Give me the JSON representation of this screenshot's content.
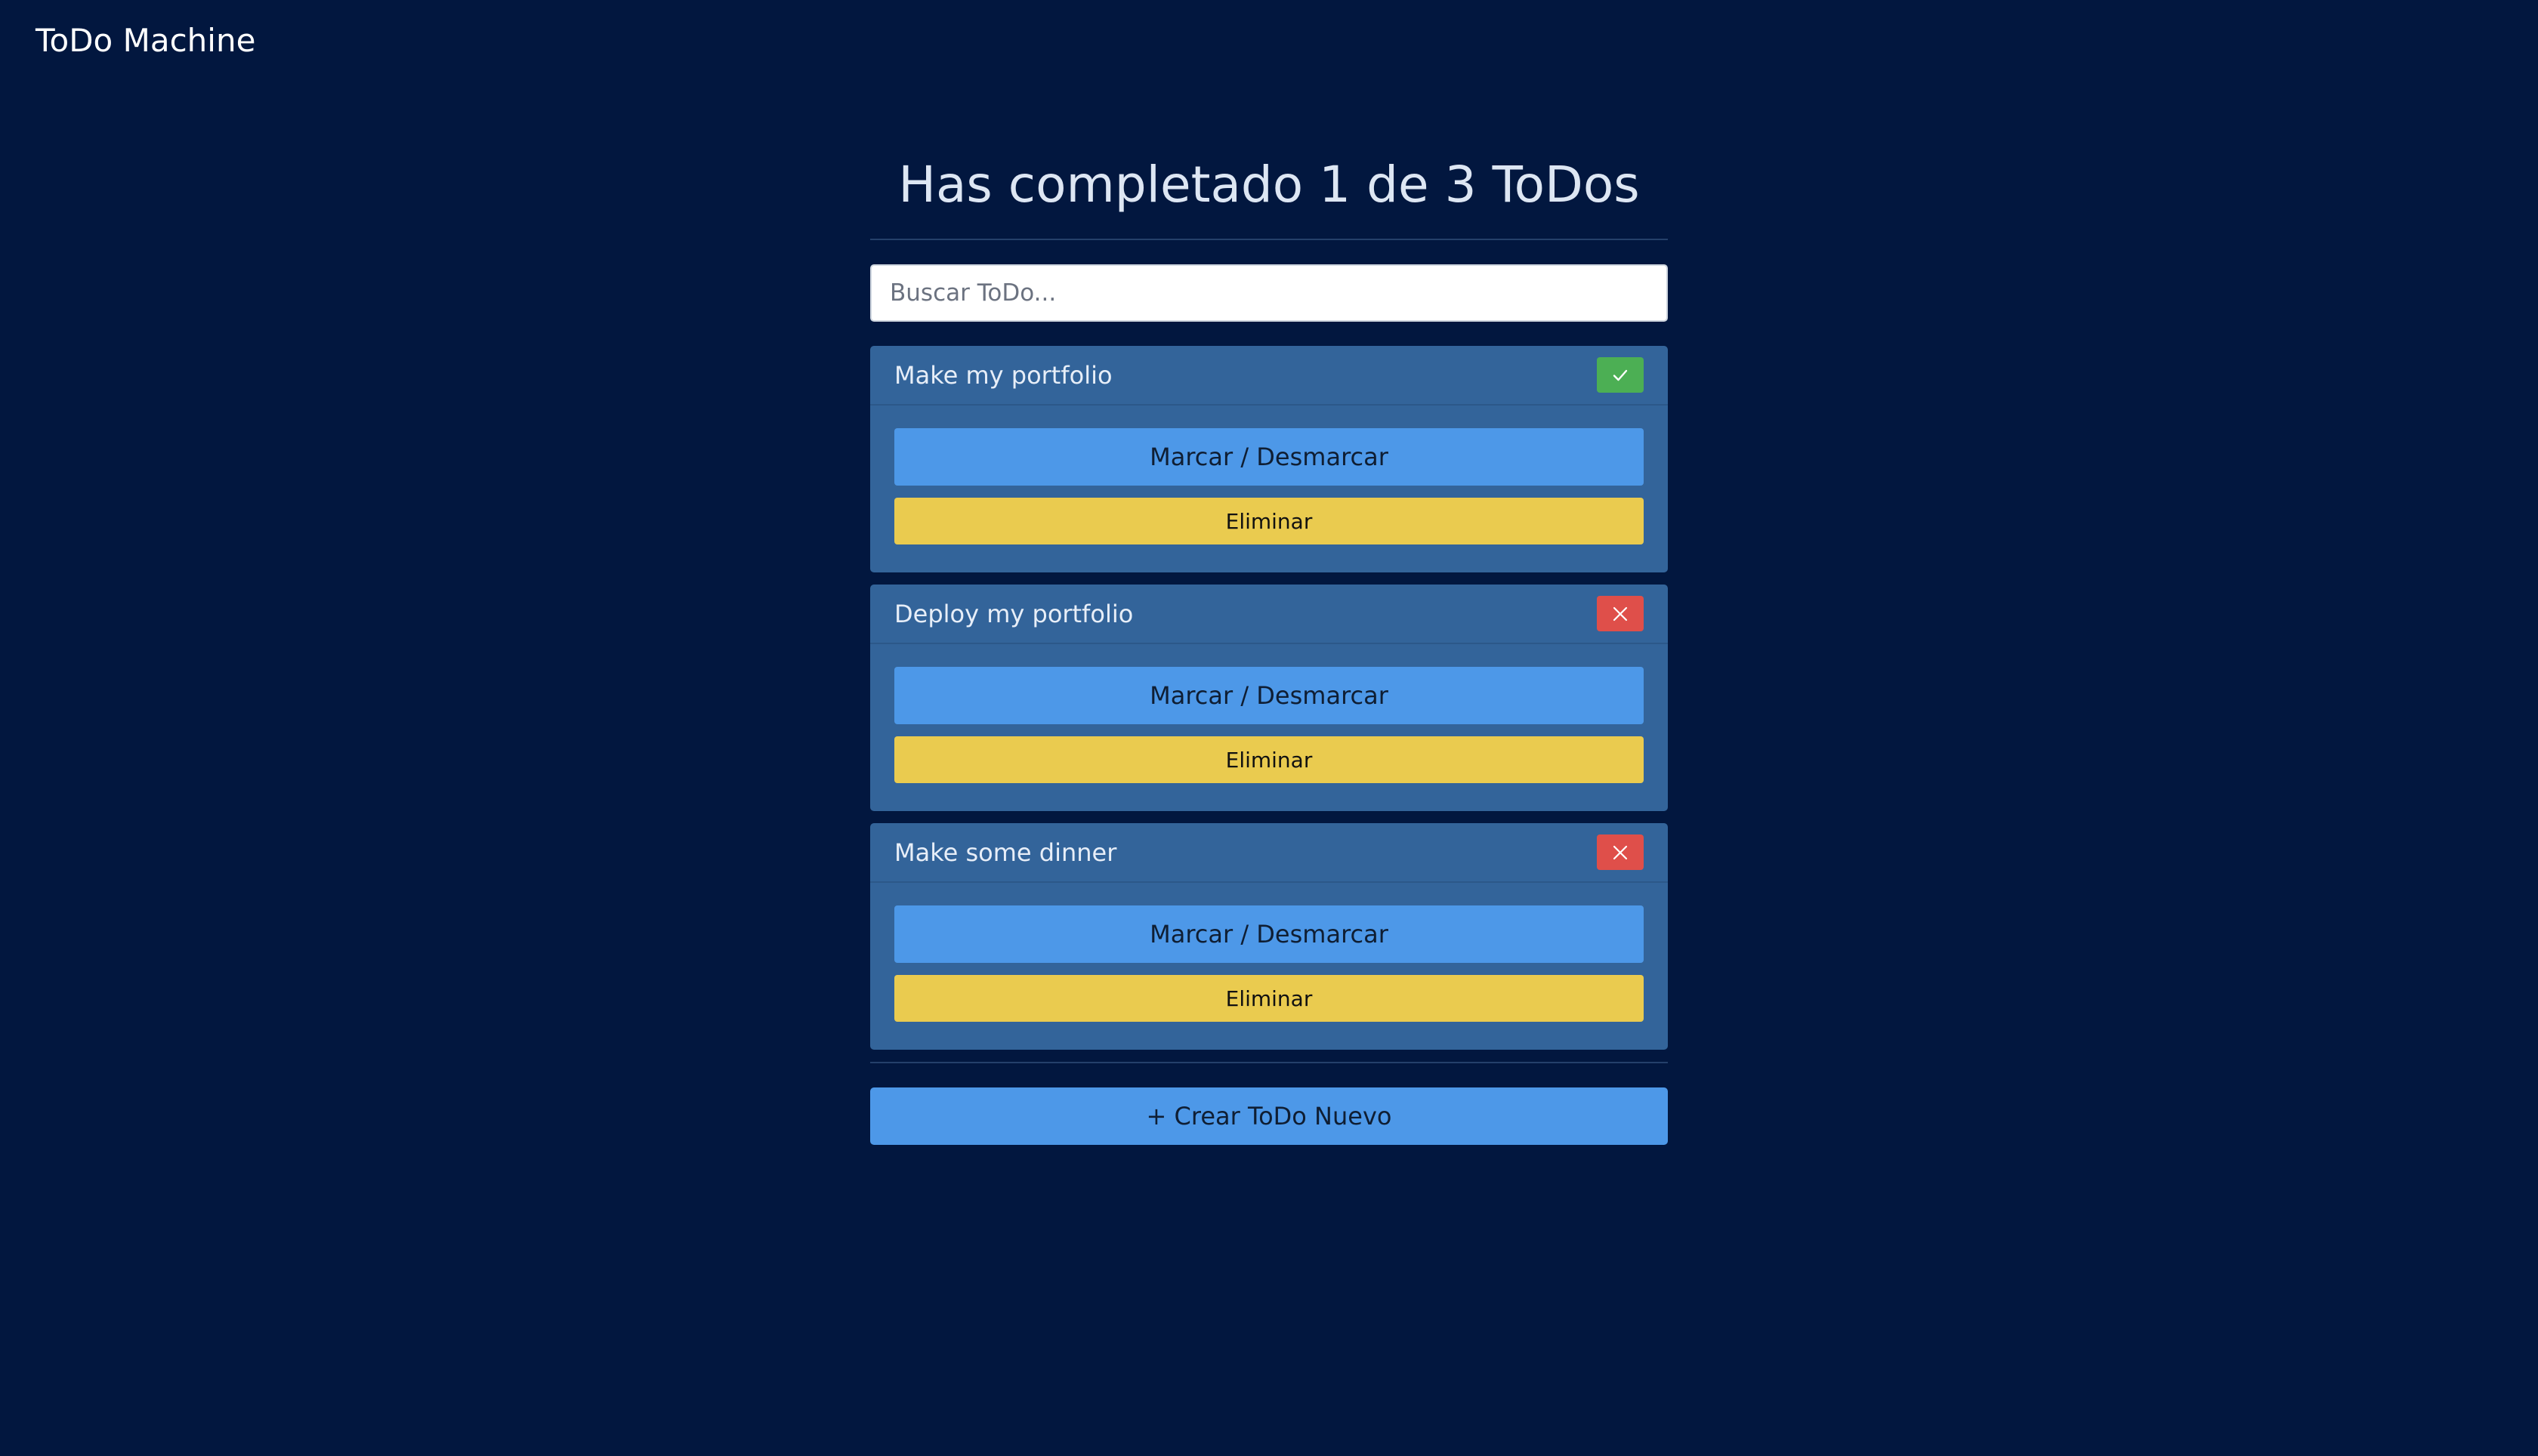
{
  "app": {
    "title": "ToDo Machine"
  },
  "counter": {
    "text": "Has completado 1 de 3 ToDos",
    "completed": 1,
    "total": 3
  },
  "search": {
    "placeholder": "Buscar ToDo...",
    "value": ""
  },
  "todos": [
    {
      "text": "Make my portfolio",
      "completed": true,
      "status_icon": "check-icon",
      "toggle_label": "Marcar / Desmarcar",
      "delete_label": "Eliminar"
    },
    {
      "text": "Deploy my portfolio",
      "completed": false,
      "status_icon": "close-icon",
      "toggle_label": "Marcar / Desmarcar",
      "delete_label": "Eliminar"
    },
    {
      "text": "Make some dinner",
      "completed": false,
      "status_icon": "close-icon",
      "toggle_label": "Marcar / Desmarcar",
      "delete_label": "Eliminar"
    }
  ],
  "create": {
    "label": "+ Crear ToDo Nuevo"
  },
  "colors": {
    "background": "#02173f",
    "card": "#33649a",
    "primary_button": "#4d98e8",
    "delete_button": "#eacb4f",
    "done": "#4caf54",
    "pending": "#df4f4a"
  }
}
